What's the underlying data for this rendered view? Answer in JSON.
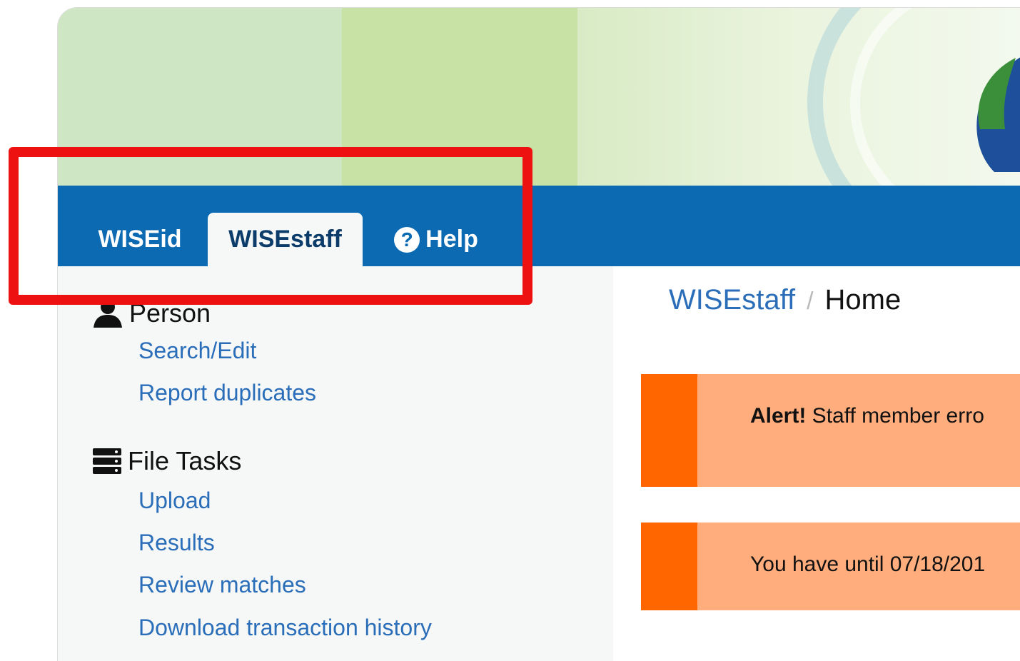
{
  "nav": {
    "tabs": [
      {
        "label": "WISEid",
        "active": false
      },
      {
        "label": "WISEstaff",
        "active": true
      },
      {
        "label": "Help",
        "active": false,
        "icon": "question-circle-icon"
      }
    ]
  },
  "sidebar": {
    "sections": [
      {
        "heading": "Person",
        "icon": "person-icon",
        "links": [
          "Search/Edit",
          "Report duplicates"
        ]
      },
      {
        "heading": "File Tasks",
        "icon": "server-stack-icon",
        "links": [
          "Upload",
          "Results",
          "Review matches",
          "Download transaction history"
        ]
      }
    ]
  },
  "breadcrumb": {
    "parent": "WISEstaff",
    "separator": "/",
    "current": "Home"
  },
  "alerts": [
    {
      "strong": "Alert!",
      "text": " Staff member erro"
    },
    {
      "strong": "",
      "text": "You have until 07/18/201"
    }
  ],
  "colors": {
    "navbar": "#0b6ab2",
    "link": "#2a6db8",
    "alert_bar": "#ff6600",
    "alert_bg": "#ffad7d",
    "annotation": "#ee1111"
  }
}
